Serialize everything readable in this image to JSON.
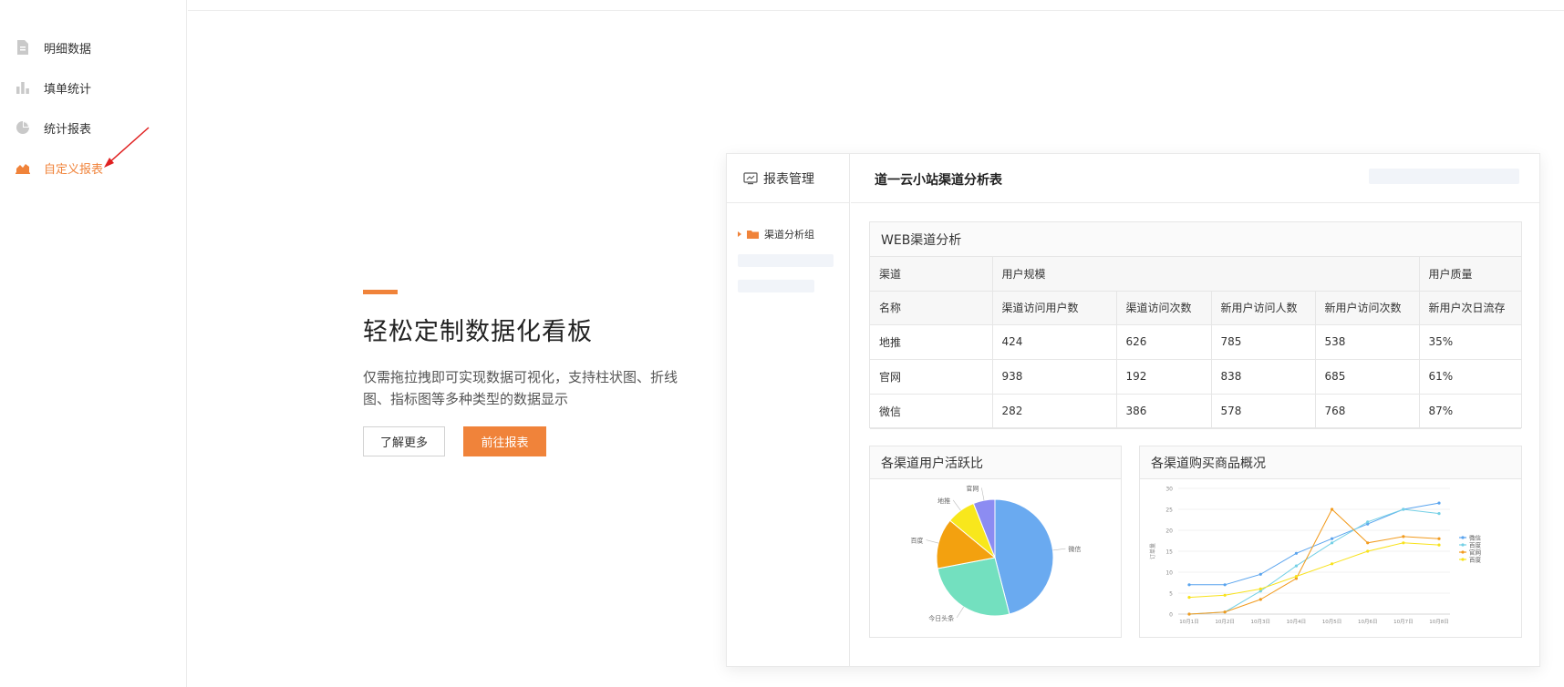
{
  "sidebar": {
    "items": [
      {
        "label": "明细数据",
        "icon": "document-icon"
      },
      {
        "label": "填单统计",
        "icon": "bar-chart-icon"
      },
      {
        "label": "统计报表",
        "icon": "pie-chart-icon"
      },
      {
        "label": "自定义报表",
        "icon": "area-chart-icon",
        "active": true
      }
    ],
    "accent_color": "#f0833a"
  },
  "promo": {
    "title": "轻松定制数据化看板",
    "description": "仅需拖拉拽即可实现数据可视化，支持柱状图、折线图、指标图等多种类型的数据显示",
    "learn_more": "了解更多",
    "go_report": "前往报表"
  },
  "preview": {
    "left_header": "报表管理",
    "folder": "渠道分析组",
    "title": "道一云小站渠道分析表",
    "table": {
      "title": "WEB渠道分析",
      "group_headers": [
        "渠道",
        "用户规模",
        "用户质量"
      ],
      "columns": [
        "名称",
        "渠道访问用户数",
        "渠道访问次数",
        "新用户访问人数",
        "新用户访问次数",
        "新用户次日流存"
      ],
      "rows": [
        [
          "地推",
          "424",
          "626",
          "785",
          "538",
          "35%"
        ],
        [
          "官网",
          "938",
          "192",
          "838",
          "685",
          "61%"
        ],
        [
          "微信",
          "282",
          "386",
          "578",
          "768",
          "87%"
        ]
      ]
    }
  },
  "chart_data": [
    {
      "type": "pie",
      "title": "各渠道用户活跃比",
      "labels": [
        "微信",
        "今日头条",
        "百度",
        "地推",
        "官网"
      ],
      "values": [
        46,
        26,
        14,
        8,
        6
      ],
      "colors": [
        "#6aaaf0",
        "#73e0bf",
        "#f3a10f",
        "#f8e71c",
        "#8c8cf2"
      ]
    },
    {
      "type": "line",
      "title": "各渠道购买商品概况",
      "ylabel": "订单量",
      "categories": [
        "10月1日",
        "10月2日",
        "10月3日",
        "10月4日",
        "10月5日",
        "10月6日",
        "10月7日",
        "10月8日"
      ],
      "ylim": [
        0,
        30
      ],
      "yticks": [
        "0",
        "5",
        "10",
        "15",
        "20",
        "25",
        "30"
      ],
      "legend_position": "right",
      "series": [
        {
          "name": "微信",
          "color": "#5aa4ee",
          "values": [
            7,
            7,
            9.5,
            14.5,
            18,
            21.5,
            25,
            26.5
          ]
        },
        {
          "name": "百度",
          "color": "#74d0e6",
          "values": [
            0,
            0.5,
            5.5,
            11.5,
            17,
            22,
            25,
            24
          ]
        },
        {
          "name": "官网",
          "color": "#f29b1e",
          "values": [
            0,
            0.5,
            3.5,
            8.5,
            25,
            17,
            18.5,
            18
          ]
        },
        {
          "name": "百度",
          "color": "#f8e21c",
          "values": [
            4,
            4.5,
            6,
            9,
            12,
            15,
            17,
            16.5
          ]
        }
      ]
    }
  ]
}
